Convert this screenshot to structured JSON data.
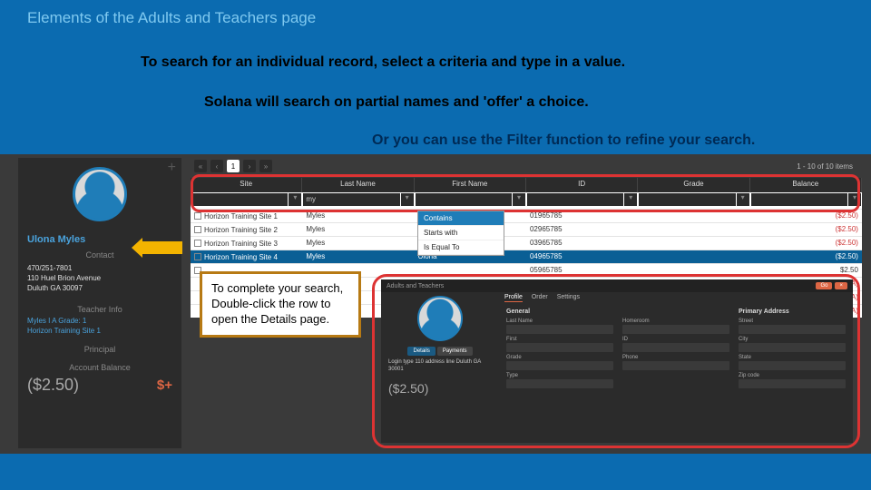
{
  "slide": {
    "title": "Elements of the Adults and Teachers page",
    "instr1": "To search for an individual record, select a criteria and type in a value.",
    "instr2": "Solana will search on partial names and 'offer' a choice.",
    "instr3": "Or you can use the Filter function to refine your search.",
    "callout": "To complete your search, Double-click the row to open the Details page."
  },
  "sidebar": {
    "name": "Ulona Myles",
    "contact_hdr": "Contact",
    "phone": "470/251-7801",
    "address1": "110 Huel Brion Avenue",
    "address2": "Duluth GA 30097",
    "teacher_hdr": "Teacher Info",
    "teacher_line1": "Myles I A  Grade: 1",
    "teacher_line2": "Horizon Training Site 1",
    "principal_hdr": "Principal",
    "account_hdr": "Account Balance",
    "balance": "($2.50)",
    "bal_plus": "$+"
  },
  "pager": {
    "count_text": "1 - 10 of 10 items"
  },
  "columns": [
    "Site",
    "Last Name",
    "First Name",
    "ID",
    "Grade",
    "Balance"
  ],
  "filter": {
    "last_name_value": "my",
    "dropdown": {
      "opt1": "Contains",
      "opt2": "Starts with",
      "opt3": "Is Equal To"
    }
  },
  "rows": [
    {
      "site": "Horizon Training Site 1",
      "last": "Myles",
      "first": "",
      "id": "01965785",
      "grade": "",
      "balance": "($2.50)"
    },
    {
      "site": "Horizon Training Site 2",
      "last": "Myles",
      "first": "",
      "id": "02965785",
      "grade": "",
      "balance": "($2.50)"
    },
    {
      "site": "Horizon Training Site 3",
      "last": "Myles",
      "first": "",
      "id": "03965785",
      "grade": "",
      "balance": "($2.50)"
    },
    {
      "site": "Horizon Training Site 4",
      "last": "Myles",
      "first": "Ulona",
      "id": "04965785",
      "grade": "",
      "balance": "($2.50)"
    },
    {
      "site": "",
      "last": "",
      "first": "",
      "id": "05965785",
      "grade": "",
      "balance": "$2.50"
    },
    {
      "site": "",
      "last": "",
      "first": "",
      "id": "",
      "grade": "",
      "balance": "($3.NA)"
    },
    {
      "site": "",
      "last": "",
      "first": "",
      "id": "",
      "grade": "",
      "balance": "($3.NA)"
    },
    {
      "site": "",
      "last": "",
      "first": "",
      "id": "",
      "grade": "",
      "balance": "($3.NA)"
    }
  ],
  "mini": {
    "breadcrumb": "Adults and Teachers",
    "go1": "Go",
    "go2": "×",
    "tab_active": "Details",
    "tab2": "Payments",
    "caption": "Login type\n110 address line\nDuluth GA 30001",
    "balance": "($2.50)",
    "tabs": {
      "t1": "Profile",
      "t2": "Order",
      "t3": "Settings"
    },
    "col1": {
      "hdr": "General",
      "f1": "Last Name",
      "f2": "First",
      "f3": "Grade",
      "f4": "Type"
    },
    "col2": {
      "hdr": "",
      "f1": "Homeroom",
      "f2": "ID",
      "f3": "Phone"
    },
    "col3": {
      "hdr": "Primary Address",
      "f1": "Street",
      "f2": "City",
      "f3": "State",
      "f4": "Zip code"
    }
  }
}
